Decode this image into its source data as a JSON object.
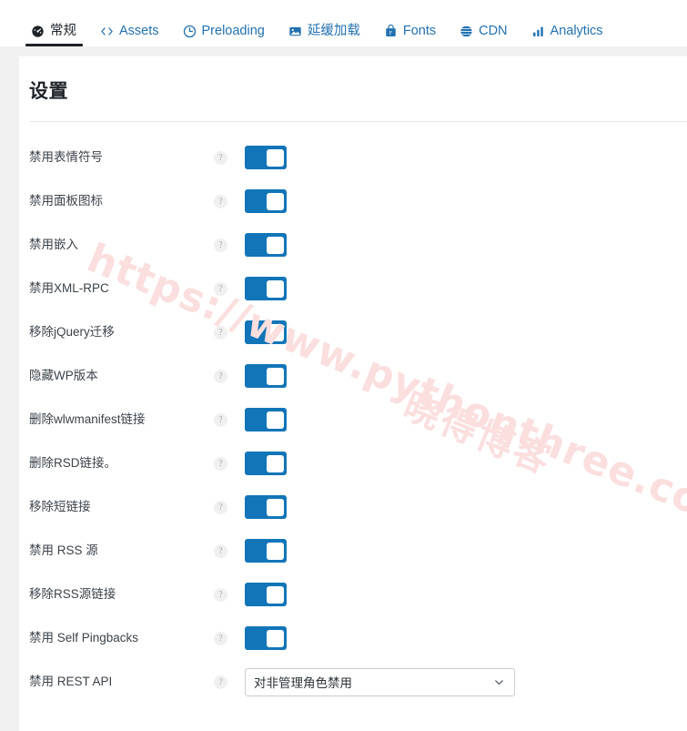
{
  "tabs": [
    {
      "label": "常规",
      "icon": "gauge-icon",
      "active": true
    },
    {
      "label": "Assets",
      "icon": "code-icon",
      "active": false
    },
    {
      "label": "Preloading",
      "icon": "clock-icon",
      "active": false
    },
    {
      "label": "延缓加载",
      "icon": "image-icon",
      "active": false
    },
    {
      "label": "Fonts",
      "icon": "font-bag-icon",
      "active": false
    },
    {
      "label": "CDN",
      "icon": "globe-icon",
      "active": false
    },
    {
      "label": "Analytics",
      "icon": "bar-chart-icon",
      "active": false
    }
  ],
  "card": {
    "title": "设置"
  },
  "help_glyph": "?",
  "settings": [
    {
      "label": "禁用表情符号",
      "control": "toggle",
      "value": "on"
    },
    {
      "label": "禁用面板图标",
      "control": "toggle",
      "value": "on"
    },
    {
      "label": "禁用嵌入",
      "control": "toggle",
      "value": "on"
    },
    {
      "label": "禁用XML-RPC",
      "control": "toggle",
      "value": "on"
    },
    {
      "label": "移除jQuery迁移",
      "control": "toggle",
      "value": "on"
    },
    {
      "label": "隐藏WP版本",
      "control": "toggle",
      "value": "on"
    },
    {
      "label": "删除wlwmanifest链接",
      "control": "toggle",
      "value": "on"
    },
    {
      "label": "删除RSD链接。",
      "control": "toggle",
      "value": "on"
    },
    {
      "label": "移除短链接",
      "control": "toggle",
      "value": "on"
    },
    {
      "label": "禁用 RSS 源",
      "control": "toggle",
      "value": "on"
    },
    {
      "label": "移除RSS源链接",
      "control": "toggle",
      "value": "on"
    },
    {
      "label": "禁用 Self Pingbacks",
      "control": "toggle",
      "value": "on"
    },
    {
      "label": "禁用 REST API",
      "control": "select",
      "value": "对非管理角色禁用"
    }
  ],
  "watermark": {
    "url": "https://www.pythonthree.com",
    "cn": "晓得博客"
  },
  "colors": {
    "accent_blue": "#1275b8",
    "link_blue": "#2271b1",
    "page_bg": "#f1f1f1",
    "card_bg": "#ffffff",
    "text_dark": "#1d2327",
    "watermark_pink": "#fbdede"
  }
}
